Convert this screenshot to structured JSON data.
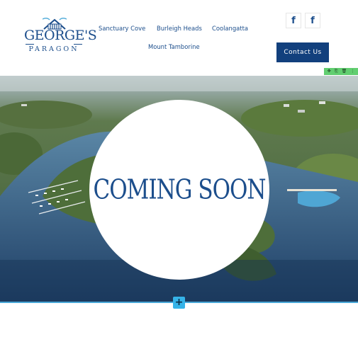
{
  "logo": {
    "main": "GEORGE'S",
    "sub": "PARAGON"
  },
  "nav": {
    "items": [
      "Sanctuary Cove",
      "Burleigh Heads",
      "Coolangatta",
      "Mount Tamborine"
    ]
  },
  "social": {
    "facebook_1": "f",
    "facebook_2": "f"
  },
  "contact": {
    "label": "Contact Us"
  },
  "editor": {
    "tools": [
      "✥",
      "⎘",
      "🗑",
      "⋮"
    ],
    "add": "+"
  },
  "hero": {
    "headline": "COMING SOON"
  },
  "colors": {
    "brand": "#1c4e8c",
    "button": "#12407d",
    "editor_green": "#61ce70",
    "editor_blue": "#35b3e8"
  },
  "icons": [
    "logo-house-icon",
    "facebook-icon",
    "move-icon",
    "duplicate-icon",
    "delete-icon",
    "more-icon",
    "plus-icon"
  ]
}
